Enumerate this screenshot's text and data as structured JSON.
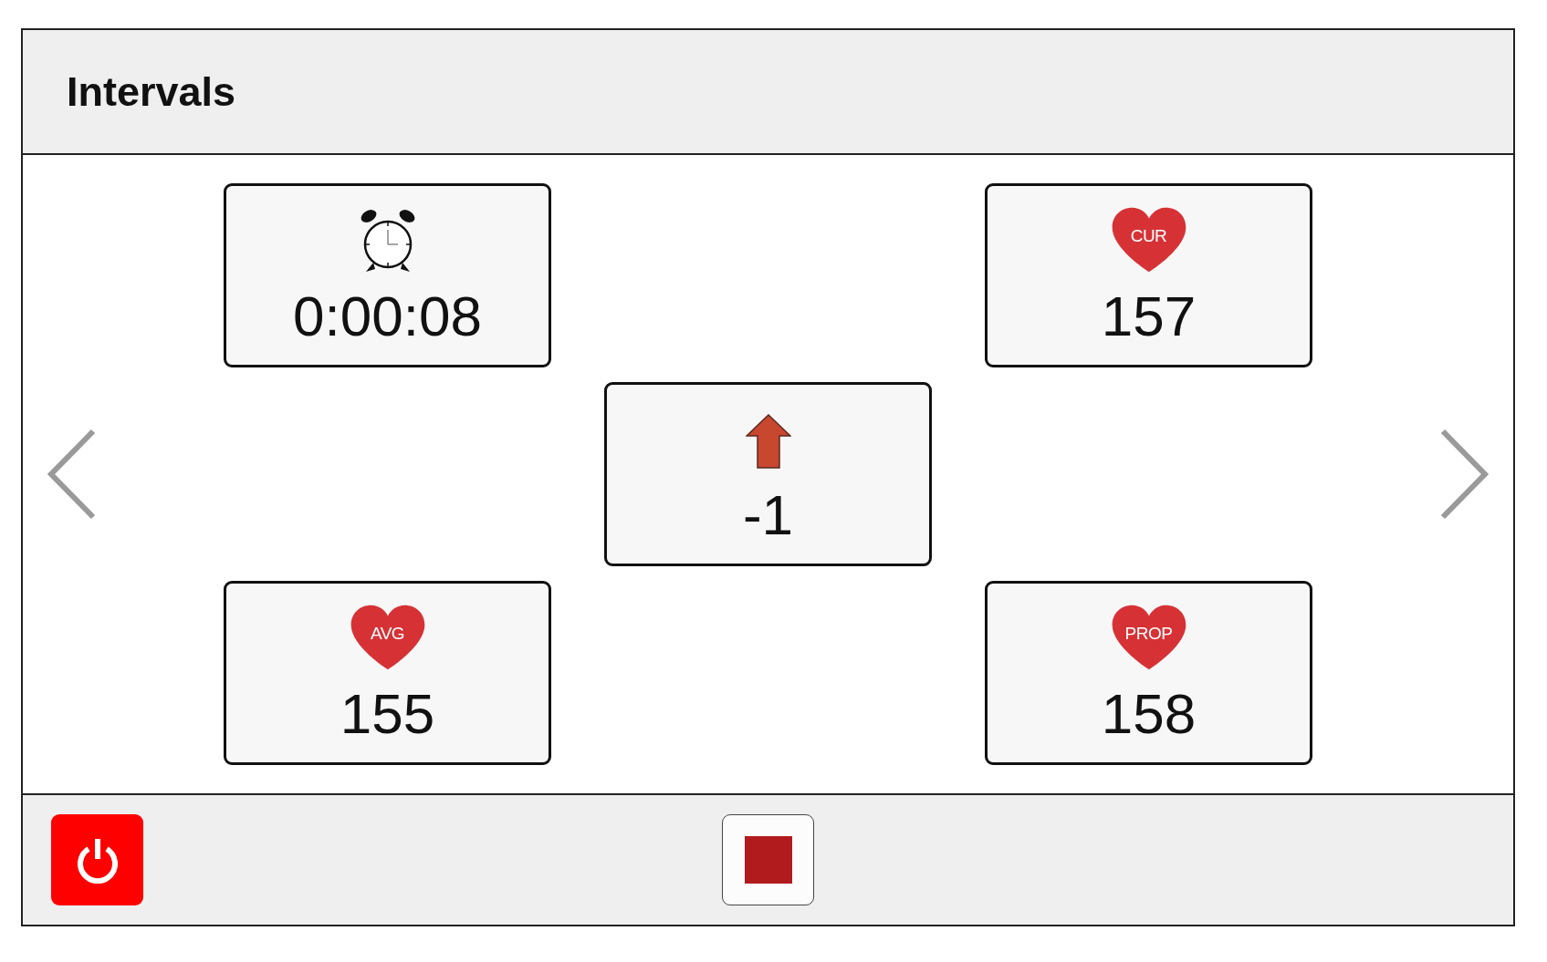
{
  "header": {
    "title": "Intervals"
  },
  "tiles": [
    {
      "kind": "timer",
      "value": "0:00:08"
    },
    {
      "kind": "heart",
      "label": "CUR",
      "value": "157"
    },
    {
      "kind": "trend",
      "rising": true,
      "value": "-1"
    },
    {
      "kind": "heart",
      "label": "AVG",
      "value": "155"
    },
    {
      "kind": "heart",
      "label": "PROP",
      "value": "158"
    }
  ]
}
